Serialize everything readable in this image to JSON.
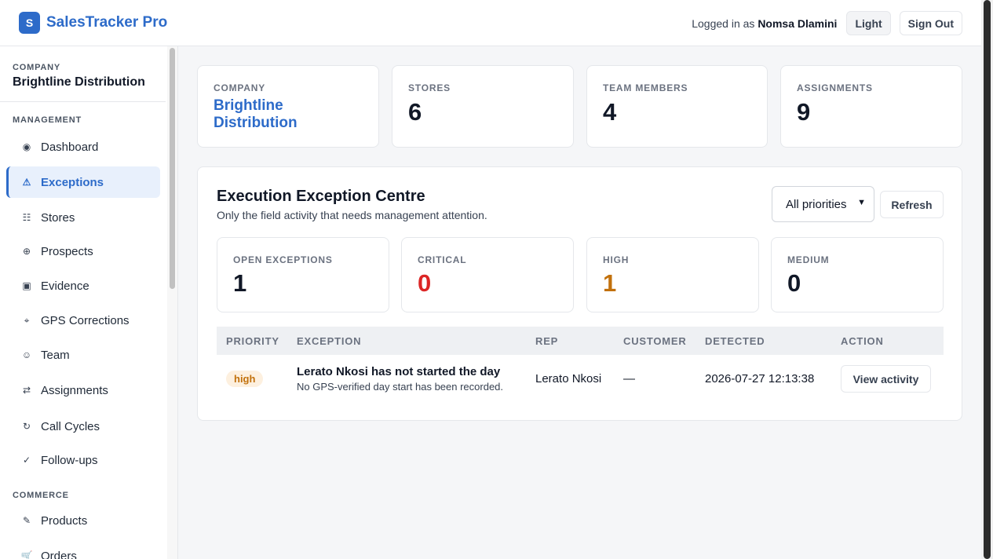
{
  "header": {
    "brand_initial": "S",
    "app_title": "SalesTracker Pro",
    "logged_prefix": "Logged in as",
    "user_name": "Nomsa Dlamini",
    "theme_button": "Light",
    "sign_out": "Sign Out"
  },
  "sidebar": {
    "company_label": "COMPANY",
    "company_name": "Brightline Distribution",
    "management_label": "MANAGEMENT",
    "commerce_label": "COMMERCE",
    "items": [
      {
        "label": "Dashboard",
        "icon": "◉"
      },
      {
        "label": "Exceptions",
        "icon": "⚠"
      },
      {
        "label": "Stores",
        "icon": "☷"
      },
      {
        "label": "Prospects",
        "icon": "⊕"
      },
      {
        "label": "Evidence",
        "icon": "▣"
      },
      {
        "label": "GPS Corrections",
        "icon": "⌖"
      },
      {
        "label": "Team",
        "icon": "☺"
      },
      {
        "label": "Assignments",
        "icon": "⇄"
      },
      {
        "label": "Call Cycles",
        "icon": "↻"
      },
      {
        "label": "Follow-ups",
        "icon": "✓"
      }
    ],
    "commerce_items": [
      {
        "label": "Products",
        "icon": "✎"
      },
      {
        "label": "Orders",
        "icon": "🛒"
      }
    ]
  },
  "stats": {
    "company_label": "COMPANY",
    "company_value": "Brightline Distribution",
    "stores_label": "STORES",
    "stores_value": "6",
    "team_label": "TEAM MEMBERS",
    "team_value": "4",
    "assignments_label": "ASSIGNMENTS",
    "assignments_value": "9"
  },
  "panel": {
    "title": "Execution Exception Centre",
    "subtitle": "Only the field activity that needs management attention.",
    "priority_filter": "All priorities",
    "refresh": "Refresh",
    "counts": {
      "open_label": "OPEN EXCEPTIONS",
      "open_value": "1",
      "critical_label": "CRITICAL",
      "critical_value": "0",
      "high_label": "HIGH",
      "high_value": "1",
      "medium_label": "MEDIUM",
      "medium_value": "0"
    },
    "colors": {
      "critical": "#dc2626",
      "high": "#c2710c",
      "accent": "#2d6bc9"
    },
    "columns": [
      "PRIORITY",
      "EXCEPTION",
      "REP",
      "CUSTOMER",
      "DETECTED",
      "ACTION"
    ],
    "rows": [
      {
        "priority": "high",
        "title": "Lerato Nkosi has not started the day",
        "description": "No GPS-verified day start has been recorded.",
        "rep": "Lerato Nkosi",
        "customer": "—",
        "detected": "2026-07-27 12:13:38",
        "action": "View activity"
      }
    ]
  }
}
